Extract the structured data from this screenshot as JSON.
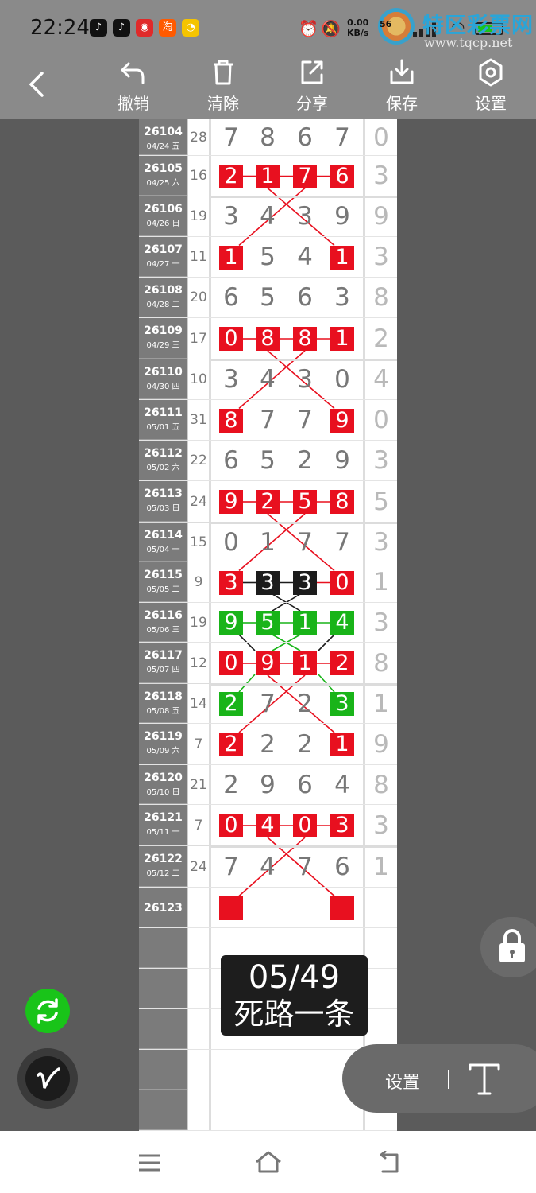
{
  "status": {
    "time": "22:24",
    "net_speed": "0.00",
    "net_unit": "KB/s",
    "battery_badge": "56",
    "watermark": "特区彩票网",
    "watermark_url": "www.tqcp.net"
  },
  "toolbar": {
    "undo": "撤销",
    "clear": "清除",
    "share": "分享",
    "save": "保存",
    "settings": "设置"
  },
  "rows": [
    {
      "issue": "26104",
      "date": "04/24 五",
      "sum": "28",
      "d": [
        "7",
        "8",
        "6",
        "7"
      ],
      "last": "0"
    },
    {
      "issue": "26105",
      "date": "04/25 六",
      "sum": "16",
      "d": [
        "2",
        "1",
        "7",
        "6"
      ],
      "last": "3"
    },
    {
      "issue": "26106",
      "date": "04/26 日",
      "sum": "19",
      "d": [
        "3",
        "4",
        "3",
        "9"
      ],
      "last": "9"
    },
    {
      "issue": "26107",
      "date": "04/27 一",
      "sum": "11",
      "d": [
        "1",
        "5",
        "4",
        "1"
      ],
      "last": "3"
    },
    {
      "issue": "26108",
      "date": "04/28 二",
      "sum": "20",
      "d": [
        "6",
        "5",
        "6",
        "3"
      ],
      "last": "8"
    },
    {
      "issue": "26109",
      "date": "04/29 三",
      "sum": "17",
      "d": [
        "0",
        "8",
        "8",
        "1"
      ],
      "last": "2"
    },
    {
      "issue": "26110",
      "date": "04/30 四",
      "sum": "10",
      "d": [
        "3",
        "4",
        "3",
        "0"
      ],
      "last": "4"
    },
    {
      "issue": "26111",
      "date": "05/01 五",
      "sum": "31",
      "d": [
        "8",
        "7",
        "7",
        "9"
      ],
      "last": "0"
    },
    {
      "issue": "26112",
      "date": "05/02 六",
      "sum": "22",
      "d": [
        "6",
        "5",
        "2",
        "9"
      ],
      "last": "3"
    },
    {
      "issue": "26113",
      "date": "05/03 日",
      "sum": "24",
      "d": [
        "9",
        "2",
        "5",
        "8"
      ],
      "last": "5"
    },
    {
      "issue": "26114",
      "date": "05/04 一",
      "sum": "15",
      "d": [
        "0",
        "1",
        "7",
        "7"
      ],
      "last": "3"
    },
    {
      "issue": "26115",
      "date": "05/05 二",
      "sum": "9",
      "d": [
        "3",
        "3",
        "3",
        "0"
      ],
      "last": "1"
    },
    {
      "issue": "26116",
      "date": "05/06 三",
      "sum": "19",
      "d": [
        "9",
        "5",
        "1",
        "4"
      ],
      "last": "3"
    },
    {
      "issue": "26117",
      "date": "05/07 四",
      "sum": "12",
      "d": [
        "0",
        "9",
        "1",
        "2"
      ],
      "last": "8"
    },
    {
      "issue": "26118",
      "date": "05/08 五",
      "sum": "14",
      "d": [
        "2",
        "7",
        "2",
        "3"
      ],
      "last": "1"
    },
    {
      "issue": "26119",
      "date": "05/09 六",
      "sum": "7",
      "d": [
        "2",
        "2",
        "2",
        "1"
      ],
      "last": "9"
    },
    {
      "issue": "26120",
      "date": "05/10 日",
      "sum": "21",
      "d": [
        "2",
        "9",
        "6",
        "4"
      ],
      "last": "8"
    },
    {
      "issue": "26121",
      "date": "05/11 一",
      "sum": "7",
      "d": [
        "0",
        "4",
        "0",
        "3"
      ],
      "last": "3"
    },
    {
      "issue": "26122",
      "date": "05/12 二",
      "sum": "24",
      "d": [
        "7",
        "4",
        "7",
        "6"
      ],
      "last": "1"
    },
    {
      "issue": "26123",
      "date": "",
      "sum": "",
      "d": [
        "",
        "",
        "",
        ""
      ],
      "last": ""
    }
  ],
  "highlights": [
    {
      "row": 1,
      "col": 0,
      "c": "red"
    },
    {
      "row": 1,
      "col": 1,
      "c": "red"
    },
    {
      "row": 1,
      "col": 2,
      "c": "red"
    },
    {
      "row": 1,
      "col": 3,
      "c": "red"
    },
    {
      "row": 3,
      "col": 0,
      "c": "red"
    },
    {
      "row": 3,
      "col": 3,
      "c": "red"
    },
    {
      "row": 5,
      "col": 0,
      "c": "red"
    },
    {
      "row": 5,
      "col": 1,
      "c": "red"
    },
    {
      "row": 5,
      "col": 2,
      "c": "red"
    },
    {
      "row": 5,
      "col": 3,
      "c": "red"
    },
    {
      "row": 7,
      "col": 0,
      "c": "red"
    },
    {
      "row": 7,
      "col": 3,
      "c": "red"
    },
    {
      "row": 9,
      "col": 0,
      "c": "red"
    },
    {
      "row": 9,
      "col": 1,
      "c": "red"
    },
    {
      "row": 9,
      "col": 2,
      "c": "red"
    },
    {
      "row": 9,
      "col": 3,
      "c": "red"
    },
    {
      "row": 11,
      "col": 0,
      "c": "red"
    },
    {
      "row": 11,
      "col": 1,
      "c": "black"
    },
    {
      "row": 11,
      "col": 2,
      "c": "black"
    },
    {
      "row": 11,
      "col": 3,
      "c": "red"
    },
    {
      "row": 12,
      "col": 0,
      "c": "green"
    },
    {
      "row": 12,
      "col": 1,
      "c": "green"
    },
    {
      "row": 12,
      "col": 2,
      "c": "green"
    },
    {
      "row": 12,
      "col": 3,
      "c": "green"
    },
    {
      "row": 13,
      "col": 0,
      "c": "red"
    },
    {
      "row": 13,
      "col": 1,
      "c": "red"
    },
    {
      "row": 13,
      "col": 2,
      "c": "red"
    },
    {
      "row": 13,
      "col": 3,
      "c": "red"
    },
    {
      "row": 14,
      "col": 0,
      "c": "green"
    },
    {
      "row": 14,
      "col": 3,
      "c": "green"
    },
    {
      "row": 15,
      "col": 0,
      "c": "red"
    },
    {
      "row": 15,
      "col": 3,
      "c": "red"
    },
    {
      "row": 17,
      "col": 0,
      "c": "red"
    },
    {
      "row": 17,
      "col": 1,
      "c": "red"
    },
    {
      "row": 17,
      "col": 2,
      "c": "red"
    },
    {
      "row": 17,
      "col": 3,
      "c": "red"
    },
    {
      "row": 19,
      "col": 0,
      "c": "red"
    },
    {
      "row": 19,
      "col": 3,
      "c": "red"
    }
  ],
  "badge": {
    "line1": "05/49",
    "line2": "死路一条"
  },
  "settings_pill": {
    "label": "设置"
  },
  "colors": {
    "red": "#e8101f",
    "green": "#19b419",
    "black": "#1c1c1c",
    "toolbar": "#8a8a8a"
  }
}
